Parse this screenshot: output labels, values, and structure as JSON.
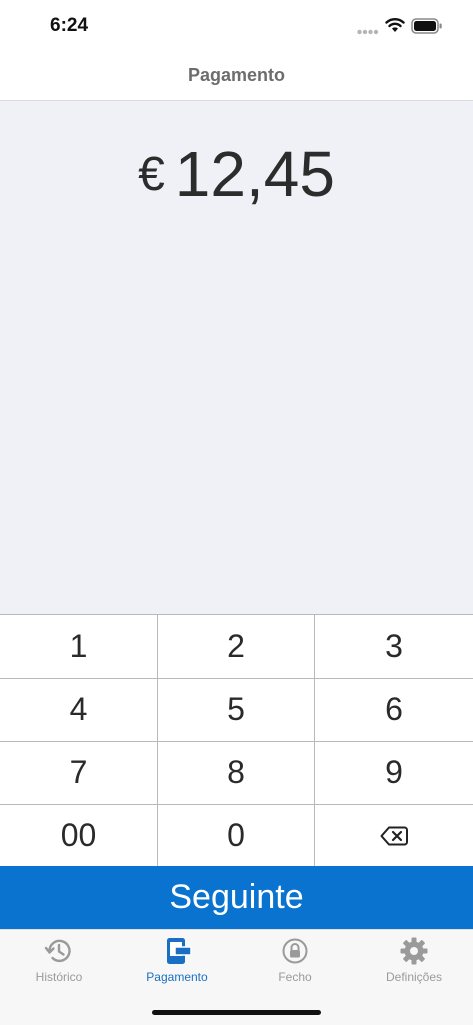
{
  "status_bar": {
    "time": "6:24"
  },
  "nav": {
    "title": "Pagamento"
  },
  "amount": {
    "currency": "€",
    "value": "12,45"
  },
  "keypad": {
    "keys": [
      "1",
      "2",
      "3",
      "4",
      "5",
      "6",
      "7",
      "8",
      "9",
      "00",
      "0"
    ],
    "backspace_icon": "backspace-icon"
  },
  "next_button": {
    "label": "Seguinte"
  },
  "tabs": [
    {
      "label": "Histórico",
      "icon": "history-icon",
      "active": false
    },
    {
      "label": "Pagamento",
      "icon": "payment-icon",
      "active": true
    },
    {
      "label": "Fecho",
      "icon": "lock-icon",
      "active": false
    },
    {
      "label": "Definições",
      "icon": "gear-icon",
      "active": false
    }
  ],
  "colors": {
    "accent": "#0a73d0",
    "tab_active": "#1a6fc4",
    "tab_inactive": "#9a9a9a",
    "amount_background": "#f0f1f6"
  }
}
